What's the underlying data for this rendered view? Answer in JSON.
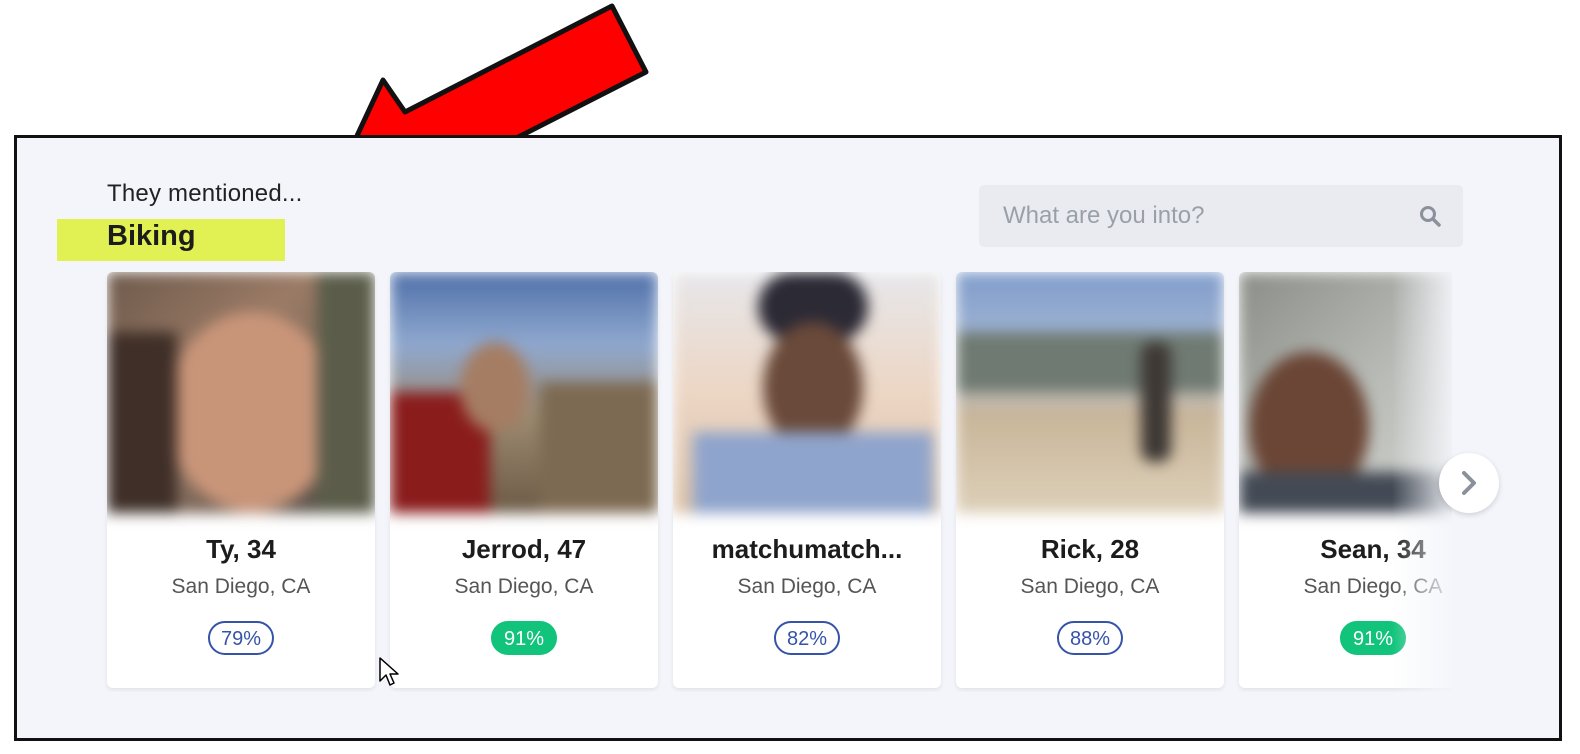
{
  "section": {
    "mentioned_label": "They mentioned...",
    "interest": "Biking",
    "highlight_color": "#e1f052"
  },
  "search": {
    "placeholder": "What are you into?",
    "icon": "search-icon"
  },
  "profiles": [
    {
      "name": "Ty, 34",
      "location": "San Diego, CA",
      "match": "79%",
      "match_style": "outline"
    },
    {
      "name": "Jerrod, 47",
      "location": "San Diego, CA",
      "match": "91%",
      "match_style": "filled"
    },
    {
      "name": "matchumatch...",
      "location": "San Diego, CA",
      "match": "82%",
      "match_style": "outline"
    },
    {
      "name": "Rick, 28",
      "location": "San Diego, CA",
      "match": "88%",
      "match_style": "outline"
    },
    {
      "name": "Sean, 34",
      "location": "San Diego, CA",
      "match": "91%",
      "match_style": "filled"
    }
  ],
  "carousel": {
    "next_icon": "chevron-right-icon"
  },
  "colors": {
    "background": "#f3f5fa",
    "match_outline": "#3553a8",
    "match_filled": "#12c37c",
    "annotation_arrow": "#ff0000"
  }
}
